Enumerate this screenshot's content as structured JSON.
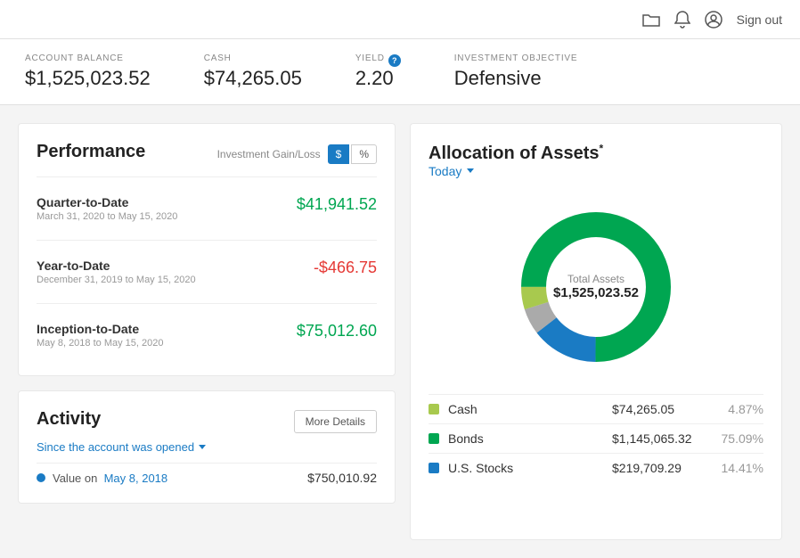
{
  "topbar": {
    "signout_label": "Sign out"
  },
  "account": {
    "balance_label": "ACCOUNT BALANCE",
    "balance_value": "$1,525,023.52",
    "cash_label": "CASH",
    "cash_value": "$74,265.05",
    "yield_label": "YIELD",
    "yield_info": "?",
    "yield_value": "2.20",
    "objective_label": "INVESTMENT OBJECTIVE",
    "objective_value": "Defensive"
  },
  "performance": {
    "title": "Performance",
    "gain_loss_label": "Investment Gain/Loss",
    "btn_dollar": "$",
    "btn_pct": "%",
    "rows": [
      {
        "label": "Quarter-to-Date",
        "sublabel": "March 31, 2020 to May 15, 2020",
        "value": "$41,941.52",
        "positive": true
      },
      {
        "label": "Year-to-Date",
        "sublabel": "December 31, 2019 to May 15, 2020",
        "value": "-$466.75",
        "positive": false
      },
      {
        "label": "Inception-to-Date",
        "sublabel": "May 8, 2018 to May 15, 2020",
        "value": "$75,012.60",
        "positive": true
      }
    ]
  },
  "activity": {
    "title": "Activity",
    "more_details": "More Details",
    "since_label": "Since the account was opened",
    "rows": [
      {
        "dot_color": "#1a7bc4",
        "label_prefix": "Value on",
        "date": "May 8, 2018",
        "value": "$750,010.92"
      }
    ]
  },
  "allocation": {
    "title": "Allocation of Assets",
    "asterisk": "*",
    "today_label": "Today",
    "donut_center_label": "Total Assets",
    "donut_center_value": "$1,525,023.52",
    "segments": [
      {
        "color": "#a8c94e",
        "pct": 4.87
      },
      {
        "color": "#00a651",
        "pct": 75.09
      },
      {
        "color": "#1a7bc4",
        "pct": 14.41
      },
      {
        "color": "#888",
        "pct": 5.63
      }
    ],
    "assets": [
      {
        "color": "#a8c94e",
        "name": "Cash",
        "amount": "$74,265.05",
        "pct": "4.87%"
      },
      {
        "color": "#00a651",
        "name": "Bonds",
        "amount": "$1,145,065.32",
        "pct": "75.09%"
      },
      {
        "color": "#1a7bc4",
        "name": "U.S. Stocks",
        "amount": "$219,709.29",
        "pct": "14.41%"
      }
    ]
  }
}
